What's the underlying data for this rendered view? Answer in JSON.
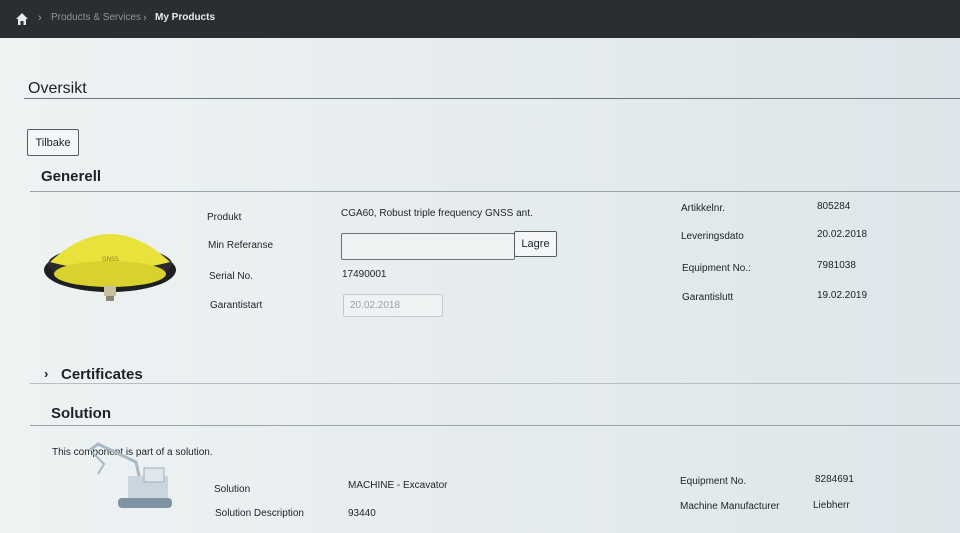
{
  "breadcrumb": {
    "items": [
      {
        "label": "Products & Services"
      },
      {
        "label": "My Products"
      }
    ]
  },
  "page": {
    "title": "Oversikt",
    "back_label": "Tilbake"
  },
  "generell": {
    "heading": "Generell",
    "left": {
      "produkt_label": "Produkt",
      "produkt_value": "CGA60, Robust triple frequency GNSS ant.",
      "referanse_label": "Min Referanse",
      "referanse_value": "",
      "save_label": "Lagre",
      "serial_label": "Serial No.",
      "serial_value": "17490001",
      "garantistart_label": "Garantistart",
      "garantistart_value": "20.02.2018"
    },
    "right": {
      "artikkelnr_label": "Artikkelnr.",
      "artikkelnr_value": "805284",
      "leveringsdato_label": "Leveringsdato",
      "leveringsdato_value": "20.02.2018",
      "equipment_label": "Equipment No.:",
      "equipment_value": "7981038",
      "garantislutt_label": "Garantislutt",
      "garantislutt_value": "19.02.2019"
    }
  },
  "certificates": {
    "heading": "Certificates"
  },
  "solution": {
    "heading": "Solution",
    "note": "This component is part of a solution.",
    "solution_label": "Solution",
    "solution_value": "MACHINE - Excavator",
    "description_label": "Solution Description",
    "description_value": "93440",
    "equipment_label": "Equipment No.",
    "equipment_value": "8284691",
    "manufacturer_label": "Machine Manufacturer",
    "manufacturer_value": "Liebherr"
  },
  "colors": {
    "topbar": "#2b2e31",
    "antenna_yellow": "#e9e23a"
  }
}
